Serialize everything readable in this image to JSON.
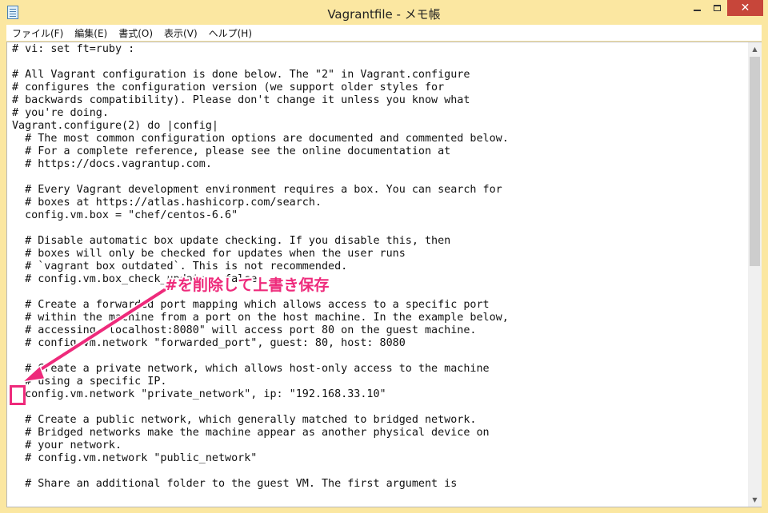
{
  "window": {
    "title": "Vagrantfile - メモ帳",
    "controls": {
      "close_glyph": "✕"
    }
  },
  "menu": {
    "items": [
      "ファイル(F)",
      "編集(E)",
      "書式(O)",
      "表示(V)",
      "ヘルプ(H)"
    ]
  },
  "editor": {
    "lines": [
      "# vi: set ft=ruby :",
      "",
      "# All Vagrant configuration is done below. The \"2\" in Vagrant.configure",
      "# configures the configuration version (we support older styles for",
      "# backwards compatibility). Please don't change it unless you know what",
      "# you're doing.",
      "Vagrant.configure(2) do |config|",
      "  # The most common configuration options are documented and commented below.",
      "  # For a complete reference, please see the online documentation at",
      "  # https://docs.vagrantup.com.",
      "",
      "  # Every Vagrant development environment requires a box. You can search for",
      "  # boxes at https://atlas.hashicorp.com/search.",
      "  config.vm.box = \"chef/centos-6.6\"",
      "",
      "  # Disable automatic box update checking. If you disable this, then",
      "  # boxes will only be checked for updates when the user runs",
      "  # `vagrant box outdated`. This is not recommended.",
      "  # config.vm.box_check_update = false",
      "",
      "  # Create a forwarded port mapping which allows access to a specific port",
      "  # within the machine from a port on the host machine. In the example below,",
      "  # accessing \"localhost:8080\" will access port 80 on the guest machine.",
      "  # config.vm.network \"forwarded_port\", guest: 80, host: 8080",
      "",
      "  # Create a private network, which allows host-only access to the machine",
      "  # using a specific IP.",
      "  config.vm.network \"private_network\", ip: \"192.168.33.10\"",
      "",
      "  # Create a public network, which generally matched to bridged network.",
      "  # Bridged networks make the machine appear as another physical device on",
      "  # your network.",
      "  # config.vm.network \"public_network\"",
      "",
      "  # Share an additional folder to the guest VM. The first argument is"
    ]
  },
  "scrollbar": {
    "position_fraction": 0.0,
    "up_glyph": "▲",
    "down_glyph": "▼"
  },
  "annotation": {
    "label": "#を削除して上書き保存",
    "color": "#ee2a7b"
  },
  "colors": {
    "titlebar": "#fbe7a1",
    "close_button": "#c7463a",
    "annotation": "#ee2a7b"
  }
}
